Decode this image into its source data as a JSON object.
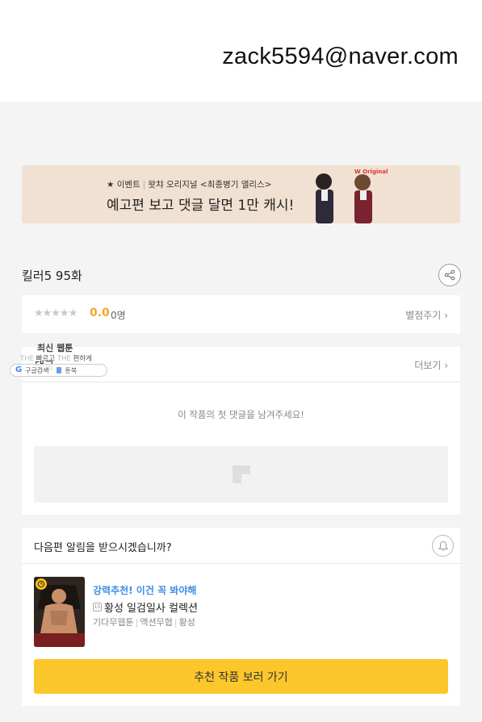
{
  "header": {
    "email": "zack5594@naver.com"
  },
  "banner": {
    "star": "★",
    "event_label": "이벤트",
    "sep": "|",
    "sub_text": "왓챠 오리지널 <최종병기 앨리스>",
    "main_text": "예고편 보고 댓글 달면 1만 캐시!",
    "logo": "W Original"
  },
  "episode": {
    "title": "킬러5 95화",
    "share_icon": "share-icon"
  },
  "rating": {
    "stars": "★★★★★",
    "score": "0.0",
    "count": "0명",
    "rate_link": "별점주기",
    "chevron": "›"
  },
  "comments": {
    "label": "댓글",
    "more_link": "더보기",
    "chevron": "›",
    "empty_text": "이 작품의 첫 댓글을 남겨주세요!"
  },
  "overlay": {
    "title": "최신 웹툰",
    "tagline_a": "THE",
    "tagline_b": "빠르고",
    "tagline_c": "THE",
    "tagline_d": "편하게",
    "g_letter": "G",
    "google_text": "구글검색",
    "book_text": "툰북"
  },
  "notify": {
    "question": "다음편 알림을 받으시겠습니까?",
    "bell_icon": "bell-icon"
  },
  "recommendation": {
    "tag": "강력추천! 이건 꼭 봐야해",
    "age": "15",
    "title": "황성 일검일사 컬렉션",
    "meta": [
      "기다무웹툰",
      "액션무협",
      "황성"
    ],
    "cta": "추천 작품 보러 가기"
  },
  "colors": {
    "accent_yellow": "#fcc72b",
    "score_orange": "#f5a623",
    "tag_blue": "#3a8ee6",
    "banner_bg": "#f1e1d2"
  }
}
